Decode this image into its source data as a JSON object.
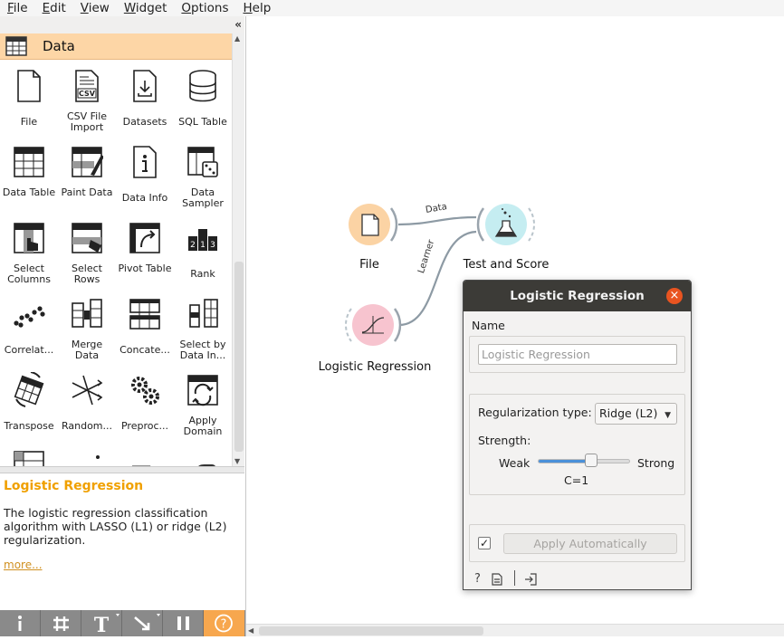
{
  "menu": [
    "File",
    "Edit",
    "View",
    "Widget",
    "Options",
    "Help"
  ],
  "toolbox": {
    "collapse_icon": "double-chevron-left-icon",
    "category": "Data",
    "widgets": [
      {
        "name": "file",
        "label": "File",
        "icon": "file-icon"
      },
      {
        "name": "csv-file-import",
        "label": "CSV File Import",
        "icon": "csv-icon"
      },
      {
        "name": "datasets",
        "label": "Datasets",
        "icon": "datasets-icon"
      },
      {
        "name": "sql-table",
        "label": "SQL Table",
        "icon": "database-icon"
      },
      {
        "name": "data-table",
        "label": "Data Table",
        "icon": "table-icon"
      },
      {
        "name": "paint-data",
        "label": "Paint Data",
        "icon": "paint-icon"
      },
      {
        "name": "data-info",
        "label": "Data Info",
        "icon": "info-icon"
      },
      {
        "name": "data-sampler",
        "label": "Data Sampler",
        "icon": "dice-icon"
      },
      {
        "name": "select-columns",
        "label": "Select Columns",
        "icon": "select-columns-icon"
      },
      {
        "name": "select-rows",
        "label": "Select Rows",
        "icon": "select-rows-icon"
      },
      {
        "name": "pivot-table",
        "label": "Pivot Table",
        "icon": "pivot-icon"
      },
      {
        "name": "rank",
        "label": "Rank",
        "icon": "rank-icon"
      },
      {
        "name": "correlations",
        "label": "Correlat...",
        "icon": "scatter-icon"
      },
      {
        "name": "merge-data",
        "label": "Merge Data",
        "icon": "merge-icon"
      },
      {
        "name": "concatenate",
        "label": "Concate...",
        "icon": "concatenate-icon"
      },
      {
        "name": "select-by-data-index",
        "label": "Select by Data In...",
        "icon": "select-index-icon"
      },
      {
        "name": "transpose",
        "label": "Transpose",
        "icon": "transpose-icon"
      },
      {
        "name": "randomize",
        "label": "Random...",
        "icon": "randomize-icon"
      },
      {
        "name": "preprocess",
        "label": "Preproc...",
        "icon": "gears-icon"
      },
      {
        "name": "apply-domain",
        "label": "Apply Domain",
        "icon": "apply-domain-icon"
      }
    ]
  },
  "description": {
    "title": "Logistic Regression",
    "text": "The logistic regression classification algorithm with LASSO (L1) or ridge (L2) regularization.",
    "more": "more..."
  },
  "bottom_toolbar": [
    "info-icon",
    "grid-icon",
    "text-icon",
    "arrow-icon",
    "pause-icon",
    "help-icon"
  ],
  "canvas": {
    "nodes": {
      "file": "File",
      "test_and_score": "Test and Score",
      "logistic_regression": "Logistic Regression"
    },
    "links": {
      "data": "Data",
      "learner": "Learner"
    }
  },
  "dialog": {
    "title": "Logistic Regression",
    "close": "×",
    "name_label": "Name",
    "name_placeholder": "Logistic Regression",
    "reg_label": "Regularization type:",
    "reg_value": "Ridge (L2)",
    "strength_label": "Strength:",
    "weak": "Weak",
    "strong": "Strong",
    "strength_position": 0.58,
    "c_value": "C=1",
    "apply_checked": "✓",
    "apply_label": "Apply Automatically"
  },
  "colors": {
    "category_bg": "#fdd6a6",
    "file_node": "#fbd3a4",
    "model_node": "#f7c4cf",
    "evaluate_node": "#c5edf1",
    "accent": "#f0a000"
  }
}
